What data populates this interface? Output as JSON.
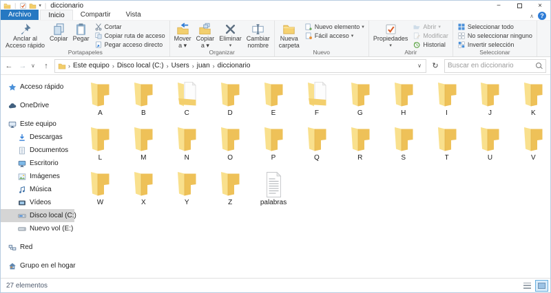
{
  "window": {
    "title": "diccionario"
  },
  "icons": {
    "back": "←",
    "forward": "→",
    "up": "↑",
    "chevron_down": "∨",
    "chevron_up": "∧",
    "dropdown": "▾",
    "crumb_sep": "›",
    "refresh": "↻",
    "help": "?",
    "minimize": "−",
    "close": "×"
  },
  "tabs": [
    {
      "label": "Archivo"
    },
    {
      "label": "Inicio",
      "selected": true
    },
    {
      "label": "Compartir"
    },
    {
      "label": "Vista"
    }
  ],
  "ribbon": {
    "groups": [
      {
        "label": "Portapapeles",
        "items": [
          {
            "id": "pin-quick-access",
            "kind": "large",
            "icon": "pin",
            "lines": [
              "Anclar al",
              "Acceso rápido"
            ]
          },
          {
            "id": "copy",
            "kind": "large",
            "icon": "copy",
            "lines": [
              "Copiar"
            ]
          },
          {
            "id": "paste",
            "kind": "large",
            "icon": "paste",
            "lines": [
              "Pegar"
            ]
          },
          {
            "kind": "smallcol",
            "items": [
              {
                "id": "cut",
                "icon": "cut",
                "label": "Cortar"
              },
              {
                "id": "copy-path",
                "icon": "copy-path",
                "label": "Copiar ruta de acceso"
              },
              {
                "id": "paste-shortcut",
                "icon": "paste-shortcut",
                "label": "Pegar acceso directo"
              }
            ]
          }
        ]
      },
      {
        "label": "Organizar",
        "items": [
          {
            "id": "move-to",
            "kind": "large",
            "icon": "move-to",
            "lines": [
              "Mover",
              "a"
            ],
            "dropdown": "inline"
          },
          {
            "id": "copy-to",
            "kind": "large",
            "icon": "copy-to",
            "lines": [
              "Copiar",
              "a"
            ],
            "dropdown": "inline"
          },
          {
            "id": "delete",
            "kind": "large",
            "icon": "delete",
            "lines": [
              "Eliminar"
            ],
            "dropdown": "below"
          },
          {
            "id": "rename",
            "kind": "large",
            "icon": "rename",
            "lines": [
              "Cambiar",
              "nombre"
            ]
          }
        ]
      },
      {
        "label": "Nuevo",
        "items": [
          {
            "id": "new-folder",
            "kind": "large",
            "icon": "new-folder",
            "lines": [
              "Nueva",
              "carpeta"
            ]
          },
          {
            "kind": "smallcol",
            "items": [
              {
                "id": "new-item",
                "icon": "new-item",
                "label": "Nuevo elemento",
                "dropdown": true
              },
              {
                "id": "easy-access",
                "icon": "easy-access",
                "label": "Fácil acceso",
                "dropdown": true
              }
            ]
          }
        ]
      },
      {
        "label": "Abrir",
        "items": [
          {
            "id": "properties",
            "kind": "large",
            "icon": "properties",
            "lines": [
              "Propiedades"
            ],
            "dropdown": "below"
          },
          {
            "kind": "smallcol",
            "items": [
              {
                "id": "open",
                "icon": "open",
                "label": "Abrir",
                "dropdown": true,
                "disabled": true
              },
              {
                "id": "edit",
                "icon": "edit",
                "label": "Modificar",
                "disabled": true
              },
              {
                "id": "history",
                "icon": "history",
                "label": "Historial"
              }
            ]
          }
        ]
      },
      {
        "label": "Seleccionar",
        "items": [
          {
            "kind": "smallcol",
            "items": [
              {
                "id": "select-all",
                "icon": "select-all",
                "label": "Seleccionar todo"
              },
              {
                "id": "select-none",
                "icon": "select-none",
                "label": "No seleccionar ninguno"
              },
              {
                "id": "select-invert",
                "icon": "select-invert",
                "label": "Invertir selección"
              }
            ]
          }
        ]
      }
    ]
  },
  "addressbar": {
    "breadcrumb": [
      "Este equipo",
      "Disco local (C:)",
      "Users",
      "juan",
      "diccionario"
    ],
    "search_placeholder": "Buscar en diccionario"
  },
  "sidebar": {
    "items": [
      {
        "label": "Acceso rápido",
        "icon": "star",
        "indent": 1
      },
      {
        "label": "OneDrive",
        "icon": "cloud",
        "indent": 1,
        "gap_before": true
      },
      {
        "label": "Este equipo",
        "icon": "computer",
        "indent": 1,
        "gap_before": true
      },
      {
        "label": "Descargas",
        "icon": "downloads",
        "indent": 2
      },
      {
        "label": "Documentos",
        "icon": "documents",
        "indent": 2
      },
      {
        "label": "Escritorio",
        "icon": "desktop",
        "indent": 2
      },
      {
        "label": "Imágenes",
        "icon": "pictures",
        "indent": 2
      },
      {
        "label": "Música",
        "icon": "music",
        "indent": 2
      },
      {
        "label": "Vídeos",
        "icon": "videos",
        "indent": 2
      },
      {
        "label": "Disco local (C:)",
        "icon": "drive-win",
        "indent": 2,
        "selected": true
      },
      {
        "label": "Nuevo vol (E:)",
        "icon": "drive",
        "indent": 2
      },
      {
        "label": "Red",
        "icon": "network",
        "indent": 1,
        "gap_before": true
      },
      {
        "label": "Grupo en el hogar",
        "icon": "homegroup",
        "indent": 1,
        "gap_before": true
      }
    ]
  },
  "files": {
    "items": [
      {
        "name": "A",
        "type": "folder"
      },
      {
        "name": "B",
        "type": "folder"
      },
      {
        "name": "C",
        "type": "folder-doc"
      },
      {
        "name": "D",
        "type": "folder"
      },
      {
        "name": "E",
        "type": "folder"
      },
      {
        "name": "F",
        "type": "folder-doc"
      },
      {
        "name": "G",
        "type": "folder"
      },
      {
        "name": "H",
        "type": "folder"
      },
      {
        "name": "I",
        "type": "folder"
      },
      {
        "name": "J",
        "type": "folder"
      },
      {
        "name": "K",
        "type": "folder"
      },
      {
        "name": "L",
        "type": "folder"
      },
      {
        "name": "M",
        "type": "folder"
      },
      {
        "name": "N",
        "type": "folder"
      },
      {
        "name": "O",
        "type": "folder"
      },
      {
        "name": "P",
        "type": "folder"
      },
      {
        "name": "Q",
        "type": "folder"
      },
      {
        "name": "R",
        "type": "folder"
      },
      {
        "name": "S",
        "type": "folder"
      },
      {
        "name": "T",
        "type": "folder"
      },
      {
        "name": "U",
        "type": "folder"
      },
      {
        "name": "V",
        "type": "folder"
      },
      {
        "name": "W",
        "type": "folder"
      },
      {
        "name": "X",
        "type": "folder"
      },
      {
        "name": "Y",
        "type": "folder"
      },
      {
        "name": "Z",
        "type": "folder"
      },
      {
        "name": "palabras",
        "type": "text-file"
      }
    ]
  },
  "statusbar": {
    "count_text": "27 elementos"
  }
}
